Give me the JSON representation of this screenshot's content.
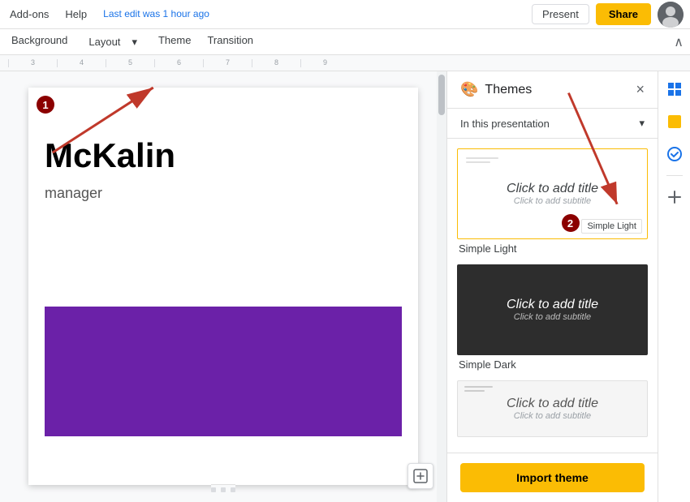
{
  "topbar": {
    "addons_label": "Add-ons",
    "help_label": "Help",
    "last_edit": "Last edit was 1 hour ago",
    "present_label": "Present",
    "share_label": "Share"
  },
  "slidemenu": {
    "background_label": "Background",
    "layout_label": "Layout",
    "theme_label": "Theme",
    "transition_label": "Transition"
  },
  "ruler": {
    "marks": [
      "3",
      "4",
      "5",
      "6",
      "7",
      "8",
      "9"
    ]
  },
  "slide": {
    "number": "1",
    "title": "McKalin",
    "subtitle": "manager"
  },
  "themes": {
    "panel_title": "Themes",
    "dropdown_label": "In this presentation",
    "close_label": "×",
    "items": [
      {
        "id": "simple-light",
        "label": "Simple Light",
        "style": "light",
        "selected": true,
        "tooltip": "Simple Light",
        "title": "Click to add title",
        "subtitle": "Click to add subtitle"
      },
      {
        "id": "simple-dark",
        "label": "Simple Dark",
        "style": "dark",
        "selected": false,
        "title": "Click to add title",
        "subtitle": "Click to add subtitle"
      },
      {
        "id": "simple-gray",
        "label": "",
        "style": "gray",
        "selected": false,
        "title": "Click to add title",
        "subtitle": "Click to add subtitle"
      }
    ],
    "import_label": "Import theme"
  },
  "sidebar": {
    "icons": [
      {
        "name": "grid-icon",
        "symbol": "⊞",
        "color": "blue"
      },
      {
        "name": "sticky-note-icon",
        "symbol": "🟡",
        "color": "yellow"
      },
      {
        "name": "check-icon",
        "symbol": "✓",
        "color": "blue"
      }
    ]
  },
  "annotations": {
    "badge1": "1",
    "badge2": "2"
  }
}
